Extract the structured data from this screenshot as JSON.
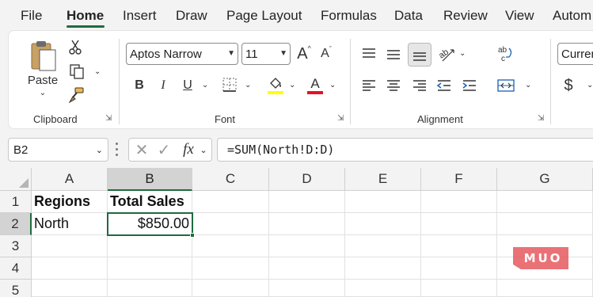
{
  "menu": {
    "tabs": [
      "File",
      "Home",
      "Insert",
      "Draw",
      "Page Layout",
      "Formulas",
      "Data",
      "Review",
      "View",
      "Autom"
    ],
    "active": "Home"
  },
  "ribbon": {
    "clipboard": {
      "paste_label": "Paste",
      "group_label": "Clipboard"
    },
    "font": {
      "font_name": "Aptos Narrow",
      "font_size": "11",
      "increase_label": "A",
      "decrease_label": "A",
      "bold_label": "B",
      "italic_label": "I",
      "underline_label": "U",
      "font_color_label": "A",
      "group_label": "Font",
      "highlight_color": "#ffff00",
      "font_color": "#e81123"
    },
    "alignment": {
      "group_label": "Alignment"
    },
    "number": {
      "format": "Curren",
      "currency_symbol": "$"
    }
  },
  "formula_bar": {
    "name_box": "B2",
    "fx_label": "fx",
    "formula": "=SUM(North!D:D)"
  },
  "sheet": {
    "columns": [
      "A",
      "B",
      "C",
      "D",
      "E",
      "F",
      "G"
    ],
    "rows": [
      "1",
      "2",
      "3",
      "4",
      "5"
    ],
    "cells": {
      "A1": "Regions",
      "B1": "Total Sales",
      "A2": "North",
      "B2": "$850.00"
    },
    "selected_cell": "B2",
    "accent_color": "#1e6b3f"
  },
  "watermark": "MUO"
}
